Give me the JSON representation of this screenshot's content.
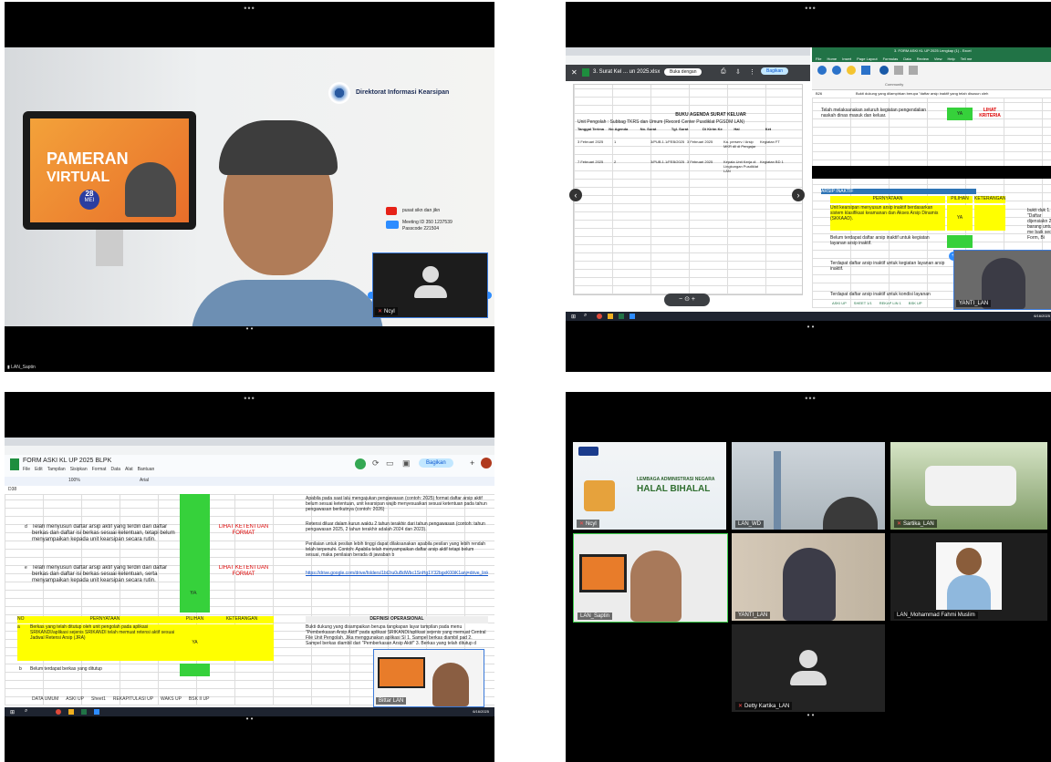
{
  "more_glyph": "•••",
  "pager_glyph": "• •",
  "q1": {
    "backdrop_title": "Direktorat Informasi Kearsipan",
    "poster_line1": "PAMERAN",
    "poster_line2": "VIRTUAL",
    "poster_date_day": "28",
    "poster_date_month": "MEI",
    "youtube_text": "pusat sikn dan jikn",
    "meeting_id_label": "Meeting ID",
    "meeting_id": "350 1237539",
    "passcode_label": "Passcode",
    "passcode": "221504",
    "self_name": "Ncyl",
    "speaker_name": "LAN_Saptin"
  },
  "q2": {
    "file_name": "3. Surat Kel ... un 2025.xlsx",
    "open_with": "Buka dengan",
    "share": "Bagikan",
    "sheet_title": "BUKU AGENDA SURAT KELUAR",
    "sheet_subtitle": "Unit Pengolah : Subbag TKRS dan Umum (Record Center Pusdiklat PGSDM LAN)",
    "columns": [
      "Tanggal Terima",
      "No Agenda",
      "No. Surat",
      "Tgl. Surat",
      "Di Kirim Ke",
      "Hal",
      "Ket"
    ],
    "rows": [
      [
        "3 Februari 2025",
        "1",
        "3/PUB.1.1/FEB/2025",
        "3 Februari 2025",
        "Ka. perserv / Arsip MKR dll di Pengajar",
        "Kegiatan FT"
      ],
      [
        "7 Februari 2025",
        "2",
        "3/PUB.1.1/FEB/2025",
        "3 Februari 2025",
        "Kepala Unit Kerja di Lingkungan Pusdiklat LAN",
        "Kegiatan BD 1"
      ]
    ],
    "excel_title": "3. FORM ASKI KL UP 2025 Lengkap (1) - Excel",
    "ribbon_tabs": [
      "File",
      "Home",
      "Insert",
      "Page Layout",
      "Formulas",
      "Data",
      "Review",
      "View",
      "Help",
      "Tell me"
    ],
    "ribbon_group": "Community",
    "formula": "Bukti dukung yang dilampirkan berupa \"daftar arsip inaktif yang telah disusun oleh",
    "statement1": "Telah melaksanakan seluruh kegiatan pengendalian naskah dinas masuk dan keluar.",
    "ya": "YA",
    "lihat_kriteria": "LIHAT KRITERIA",
    "section_title": "ARSIP INAKTIF",
    "header_pernyataan": "PERNYATAAN",
    "header_pilihan": "PILIHAN",
    "header_keterangan": "KETERANGAN",
    "row_a": "Unit kearsipan menyusun arsip inaktif berdasarkan sistem klasifikasi keamanan dan Akses Arsip Dinamis (SKKAAD).",
    "row_b": "Belum terdapat daftar arsip inaktif untuk kegiatan layanan arsip inaktif.",
    "row_c": "Terdapat daftar arsip inaktif untuk kegiatan layanan arsip inaktif.",
    "row_d": "Terdapat daftar arsip inaktif untuk kondisi layanan",
    "side_note": "bukti duk 1. \"Daftar dijensiakn 2. barang untuk me baik seca Form, Bi",
    "sheet_tabs": [
      "ASKI UP",
      "SHEET 1/1",
      "REKAP LIN 1",
      "BSK UP"
    ],
    "self_name": "YANTI_LAN",
    "clock": "6/16/2025"
  },
  "q3": {
    "doc_title": "FORM ASKI KL UP 2025 BLPK",
    "menu": [
      "File",
      "Edit",
      "Tampilan",
      "Sisipkan",
      "Format",
      "Data",
      "Alat",
      "Bantuan"
    ],
    "share": "Bagikan",
    "font": "Arial",
    "zoom": "100%",
    "cell_ref": "D38",
    "rowA_letter": "d",
    "rowA_text": "Telah menyusun daftar arsip aktif yang terdiri dari daftar berkas dan daftar isi berkas sesuai ketentuan, tetapi belum menyampaikan kepada unit kearsipan secara rutin.",
    "rowB_letter": "e",
    "rowB_text": "Telah menyusun daftar arsip aktif yang terdiri dari daftar berkas dan daftar isi berkas sesuai ketentuan, serta menyampaikan kepada unit kearsipan secara rutin.",
    "lihat_format": "LIHAT KETENTUAN FORMAT",
    "ya": "YA",
    "right_text1": "Apabila pada saat lalu mengajukan pengawasan (contoh: 2025) format daftar arsip aktif belum sesuai ketentuan, unit kearsipan wajib menyesuaikan sesuai ketentuan pada tahun pengawasan berikutnya (contoh: 2026)",
    "right_text2": "Retensi diluar dalam kurun waktu 2 tahun terakhir dari tahun pengawasan (contoh: tahun pengawasan 2025, 2 tahun terakhir adalah 2024 dan 2023).",
    "right_text3": "Penilaian untuk pesilan lebih tinggi dapat dilaksanakan apabila pesilan yang lebih rendah telah terpenuhi. Contoh: Apabila telah menyampaikan daftar arsip aktif tetapi belum sesuai, maka penilaian berada di jawaban b",
    "link": "https://drive.google.com/drive/folders/1bt2ru0uBdWbc1SnHg1Y32bgxK00iK1anj=drive_link",
    "no_header": "NO",
    "pernyataan_header": "PERNYATAAN",
    "pilihan_header": "PILIHAN",
    "keterangan_header": "KETERANGAN",
    "def_header": "DEFINISI OPERASIONAL",
    "row_a_letter": "a",
    "row_a_text": "Berkas yang telah ditutup oleh unit pengolah pada aplikasi SRIKANDI/aplikasi sejenis SRIKANDI telah memuat retensi aktif sesuai Jadwal Retensi Arsip (JRA)",
    "row_a_ya": "YA",
    "row_b_letter": "b",
    "row_b_text": "Belum terdapat berkas yang ditutup",
    "def_text": "Bukti dukung yang disampaikan berupa tangkapan layar tampilan pada menu \"Pemberkasan Arsip Aktif\" pada aplikasi SRIKANDI/aplikasi sejenis yang memuat Central File Unit Pengolah. Jika menggunakan aplikasi SI 1. Sampel berkas diambil pad 2. Sampel berkas diambil dari \"Pemberkasan Arsip Aktif\" 3. Berkas yang telah ditutup d",
    "sheet_tabs": [
      "DATA UMUM",
      "ASKI UP",
      "Sheet1",
      "REKAPITULASI UP",
      "WAKS UP",
      "BSK II UP"
    ],
    "self_name": "Bittar LAN",
    "clock": "6/16/2025"
  },
  "q4": {
    "tiles": [
      {
        "name": "Ncyl",
        "banner_small": "LEMBAGA ADMINISTRASI NEGARA",
        "banner_big": "HALAL BIHALAL"
      },
      {
        "name": "LAN_WD"
      },
      {
        "name": "Sartika_LAN"
      },
      {
        "name": "LAN_Saptin"
      },
      {
        "name": "YANTI_LAN"
      },
      {
        "name": "LAN_Mohammad Fahmi Muslim"
      },
      {
        "name": "Detty Kartika_LAN"
      }
    ]
  },
  "colors": {
    "zoom_bg": "#000000",
    "active_border": "#3b7ad9",
    "excel_green": "#217346",
    "sheet_yellow": "#ffff00",
    "sheet_green": "#36d13b"
  }
}
